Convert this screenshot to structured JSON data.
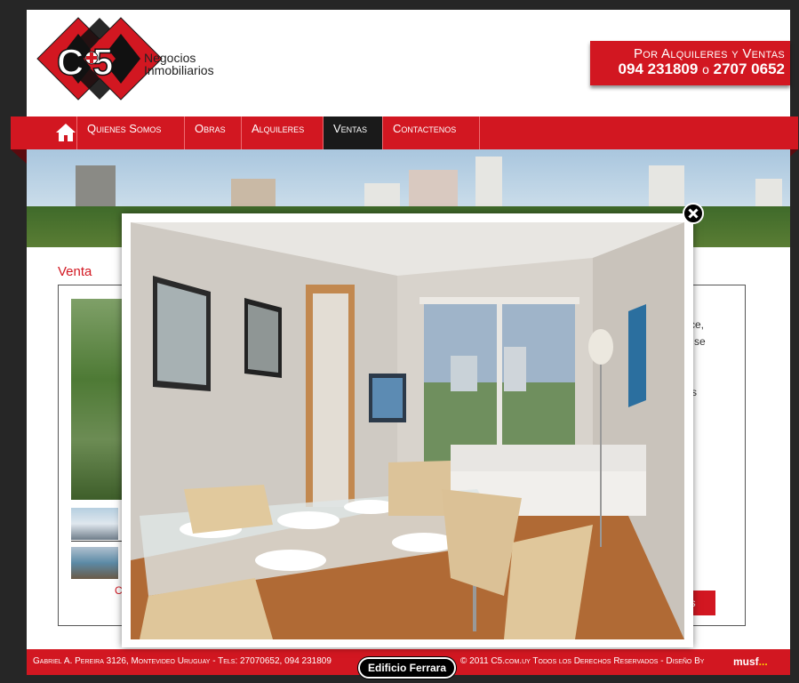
{
  "header": {
    "logo_text": "C+5",
    "logo_line1": "Negocios",
    "logo_line2": "Inmobiliarios",
    "contact_line1": "Por Alquileres y Ventas",
    "phone1": "094 231809",
    "phone_sep": "o",
    "phone2": "2707 0652"
  },
  "nav": {
    "home_icon": "home-icon",
    "items": [
      {
        "label": "Quienes Somos"
      },
      {
        "label": "Obras"
      },
      {
        "label": "Alquileres"
      },
      {
        "label": "Ventas",
        "active": true
      },
      {
        "label": "Contactenos"
      }
    ]
  },
  "content": {
    "section_title": "Venta",
    "fragment1": "ce,",
    "fragment2": "se",
    "fragment3": "s",
    "fragment_red": "C",
    "button_fragment": "es"
  },
  "footer": {
    "address": "Gabriel A. Pereira 3126, Montevideo Uruguay - Tels: 27070652, 094 231809",
    "copyright": "© 2011 C5.com.uy Todos los Derechos Reservados - Diseño By",
    "brand": "musf"
  },
  "modal": {
    "caption": "Edificio Ferrara",
    "close_icon": "close-icon"
  },
  "colors": {
    "brand_red": "#d21721",
    "dark": "#1a1a1a",
    "background": "#262626"
  }
}
